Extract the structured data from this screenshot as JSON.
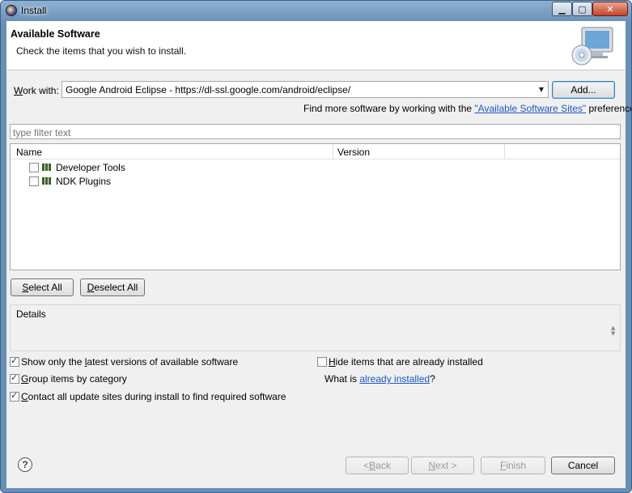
{
  "window": {
    "title": "Install"
  },
  "header": {
    "title": "Available Software",
    "subtitle": "Check the items that you wish to install."
  },
  "work_with": {
    "label_pre": "",
    "label_u": "W",
    "label_post": "ork with:",
    "value": "Google Android Eclipse - https://dl-ssl.google.com/android/eclipse/",
    "add_label": "Add..."
  },
  "find_more": {
    "prefix": "Find more software by working with the ",
    "link": "\"Available Software Sites\"",
    "suffix": " preferences."
  },
  "filter": {
    "placeholder": "type filter text"
  },
  "table": {
    "columns": [
      "Name",
      "Version"
    ],
    "rows": [
      {
        "name": "Developer Tools",
        "version": ""
      },
      {
        "name": "NDK Plugins",
        "version": ""
      }
    ]
  },
  "buttons": {
    "select_all_u": "S",
    "select_all_rest": "elect All",
    "deselect_all_u": "D",
    "deselect_all_rest": "eselect All"
  },
  "details": {
    "label": "Details"
  },
  "options": {
    "latest_pre": "Show only the ",
    "latest_u": "l",
    "latest_post": "atest versions of available software",
    "group_u": "G",
    "group_post": "roup items by category",
    "contact_u": "C",
    "contact_post": "ontact all update sites during install to find required software",
    "hide_u": "H",
    "hide_post": "ide items that are already installed",
    "what_is_prefix": "What is ",
    "what_is_link": "already installed",
    "what_is_suffix": "?"
  },
  "footer": {
    "back_pre": "< ",
    "back_u": "B",
    "back_post": "ack",
    "next_u": "N",
    "next_post": "ext >",
    "finish_u": "F",
    "finish_post": "inish",
    "cancel": "Cancel"
  },
  "icons": {
    "window_app": "eclipse-icon",
    "banner": "install-monitor-cd-icon",
    "category": "category-package-icon",
    "help": "help-icon"
  },
  "colors": {
    "link": "#1a56c8",
    "titlebar": "#6d93bb"
  }
}
